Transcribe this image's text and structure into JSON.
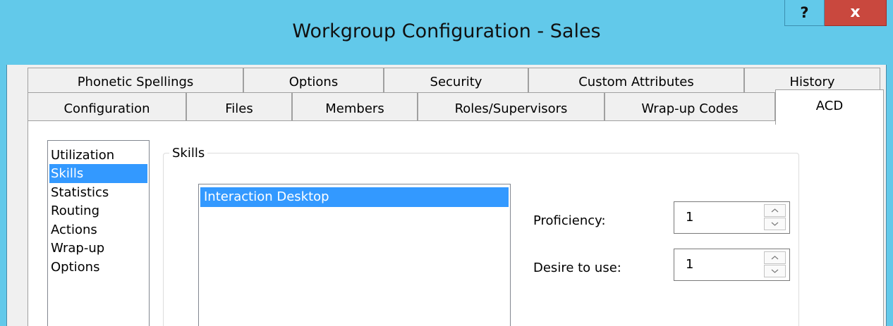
{
  "window": {
    "title": "Workgroup Configuration - Sales",
    "help_label": "?",
    "close_label": "x"
  },
  "tabs": {
    "row1": [
      "Phonetic Spellings",
      "Options",
      "Security",
      "Custom Attributes",
      "History"
    ],
    "row2": [
      "Configuration",
      "Files",
      "Members",
      "Roles/Supervisors",
      "Wrap-up Codes",
      "ACD"
    ],
    "selected": "ACD"
  },
  "categories": {
    "items": [
      "Utilization",
      "Skills",
      "Statistics",
      "Routing",
      "Actions",
      "Wrap-up",
      "Options"
    ],
    "selected": "Skills"
  },
  "skills": {
    "group_label": "Skills",
    "items": [
      "Interaction Desktop"
    ],
    "selected": "Interaction Desktop",
    "proficiency_label": "Proficiency:",
    "proficiency_value": "1",
    "desire_label": "Desire to use:",
    "desire_value": "1"
  },
  "icons": {
    "spin_up": "chevron-up-icon",
    "spin_down": "chevron-down-icon"
  },
  "colors": {
    "titlebar": "#62c9ea",
    "close_button": "#c9483e",
    "selection": "#3399ff"
  }
}
